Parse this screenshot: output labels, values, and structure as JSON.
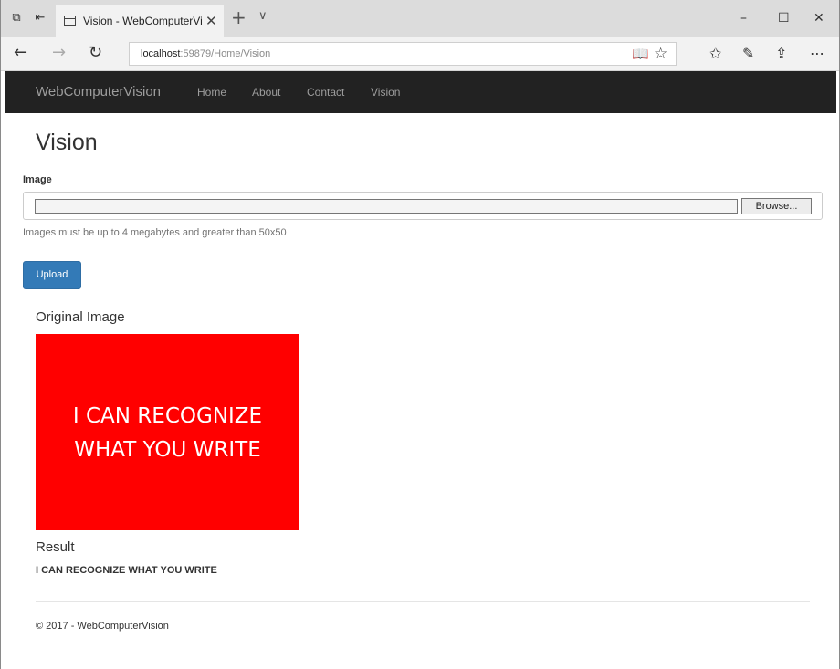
{
  "browser": {
    "tab_title": "Vision - WebComputerVision",
    "url_host": "localhost",
    "url_path": ":59879/Home/Vision",
    "icons": [
      "tab-manager-icon",
      "set-aside-tabs-icon",
      "page-icon",
      "close-icon",
      "plus-icon",
      "chevron-down-icon",
      "minimize-icon",
      "maximize-icon",
      "window-close-icon",
      "back-icon",
      "forward-icon",
      "refresh-icon",
      "reading-view-icon",
      "star-icon",
      "favorites-icon",
      "pen-icon",
      "share-icon",
      "more-icon"
    ]
  },
  "navbar": {
    "brand": "WebComputerVision",
    "links": [
      "Home",
      "About",
      "Contact",
      "Vision"
    ],
    "background": "#222222",
    "link_color": "#9d9d9d"
  },
  "page": {
    "title": "Vision",
    "image_label": "Image",
    "browse_label": "Browse...",
    "help_text": "Images must be up to 4 megabytes and greater than 50x50",
    "upload_label": "Upload",
    "upload_color": "#337ab7",
    "original_heading": "Original Image",
    "original_image_text_line1": "I CAN RECOGNIZE",
    "original_image_text_line2": "WHAT YOU WRITE",
    "original_image_color": "#ff0000",
    "result_heading": "Result",
    "result_text": "I CAN RECOGNIZE WHAT YOU WRITE",
    "footer": "© 2017 - WebComputerVision"
  }
}
